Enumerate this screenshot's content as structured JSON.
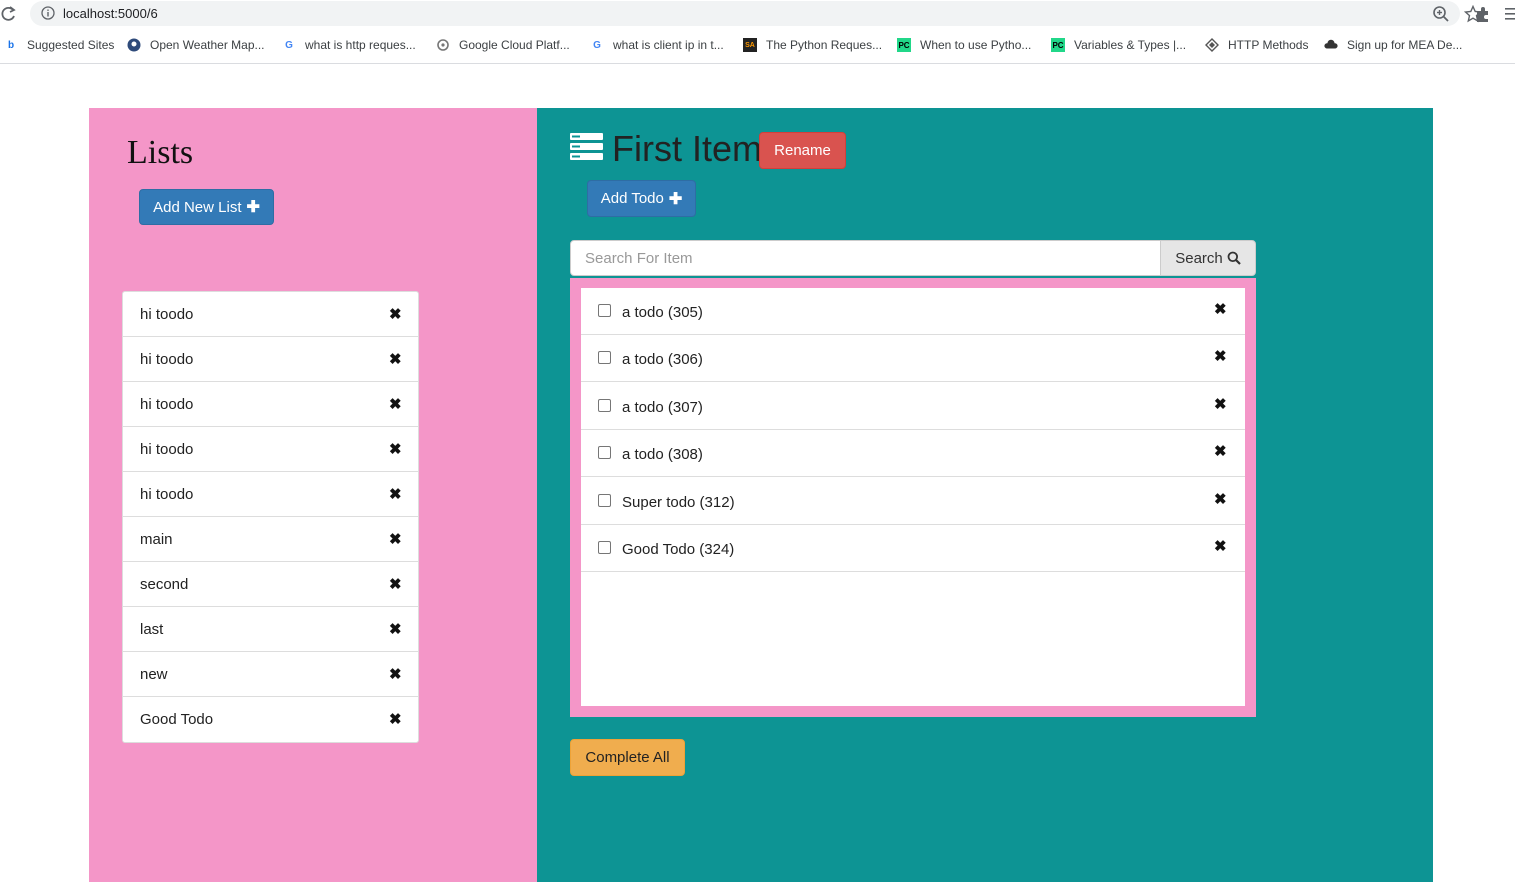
{
  "browser": {
    "url": "localhost:5000/6",
    "bookmarks": [
      {
        "label": "Suggested Sites",
        "icon": "bing-icon"
      },
      {
        "label": "Open Weather Map...",
        "icon": "weather-icon"
      },
      {
        "label": "what is http reques...",
        "icon": "google-icon"
      },
      {
        "label": "Google Cloud Platf...",
        "icon": "gcp-icon"
      },
      {
        "label": "what is client ip in t...",
        "icon": "google-icon"
      },
      {
        "label": "The Python Reques...",
        "icon": "stackabuse-icon"
      },
      {
        "label": "When to use Pytho...",
        "icon": "pycharm-icon"
      },
      {
        "label": "Variables & Types |...",
        "icon": "pycharm-icon"
      },
      {
        "label": "HTTP Methods",
        "icon": "http-icon"
      },
      {
        "label": "Sign up for MEA De...",
        "icon": "cloud-icon"
      }
    ]
  },
  "sidebar": {
    "title": "Lists",
    "add_button": "Add New List",
    "add_icon": "✚",
    "items": [
      {
        "label": "hi toodo"
      },
      {
        "label": "hi toodo"
      },
      {
        "label": "hi toodo"
      },
      {
        "label": "hi toodo"
      },
      {
        "label": "hi toodo"
      },
      {
        "label": "main"
      },
      {
        "label": "second"
      },
      {
        "label": "last"
      },
      {
        "label": "new"
      },
      {
        "label": "Good Todo"
      }
    ],
    "remove_glyph": "✖"
  },
  "main": {
    "title": "First Item",
    "rename_button": "Rename",
    "add_todo_button": "Add Todo",
    "search": {
      "placeholder": "Search For Item",
      "button": "Search",
      "value": ""
    },
    "todos": [
      {
        "label": "a todo (305)",
        "checked": false
      },
      {
        "label": "a todo (306)",
        "checked": false
      },
      {
        "label": "a todo (307)",
        "checked": false
      },
      {
        "label": "a todo (308)",
        "checked": false
      },
      {
        "label": "Super todo (312)",
        "checked": false
      },
      {
        "label": "Good Todo (324)",
        "checked": false
      }
    ],
    "complete_all_button": "Complete All"
  },
  "colors": {
    "left_panel": "#f496c8",
    "right_panel": "#0d9494",
    "primary": "#337ab7",
    "danger": "#d9534f",
    "warning": "#f0ad4e"
  }
}
